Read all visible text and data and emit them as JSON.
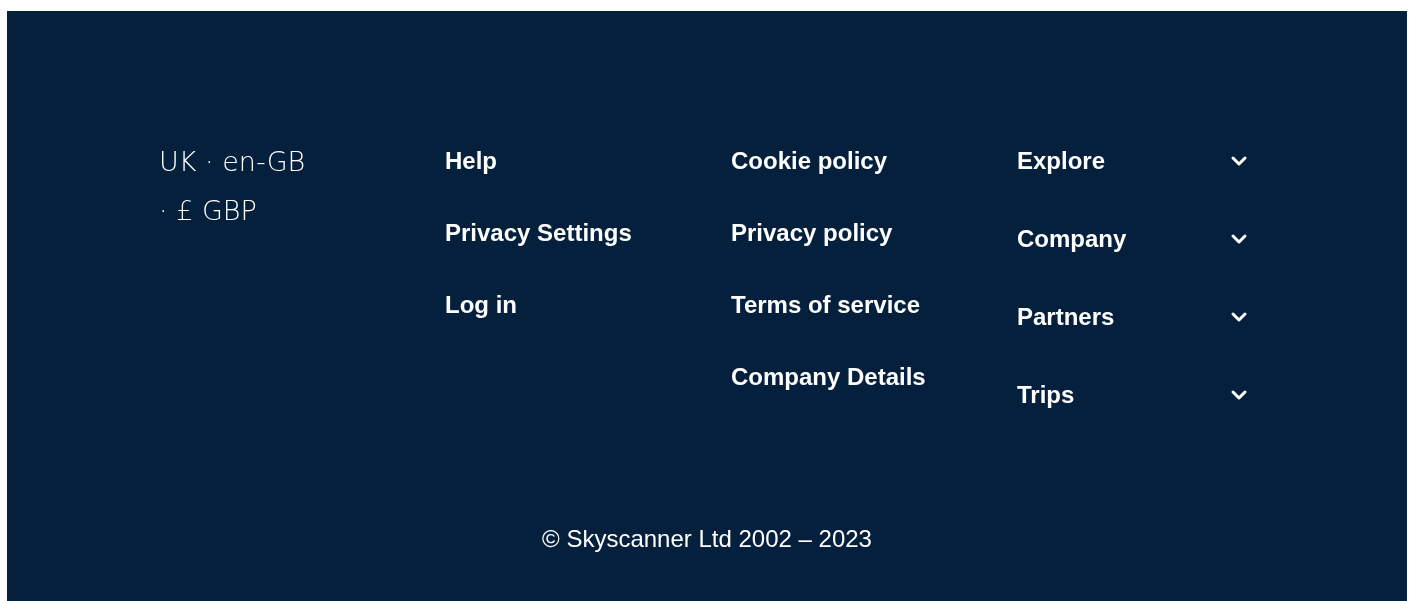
{
  "locale": "UK · en-GB · £ GBP",
  "link_columns": [
    [
      "Help",
      "Privacy Settings",
      "Log in"
    ],
    [
      "Cookie policy",
      "Privacy policy",
      "Terms of service",
      "Company Details"
    ]
  ],
  "accordions": [
    {
      "label": "Explore",
      "expanded": false
    },
    {
      "label": "Company",
      "expanded": false
    },
    {
      "label": "Partners",
      "expanded": false
    },
    {
      "label": "Trips",
      "expanded": false
    }
  ],
  "copyright": "© Skyscanner Ltd 2002 – 2023"
}
